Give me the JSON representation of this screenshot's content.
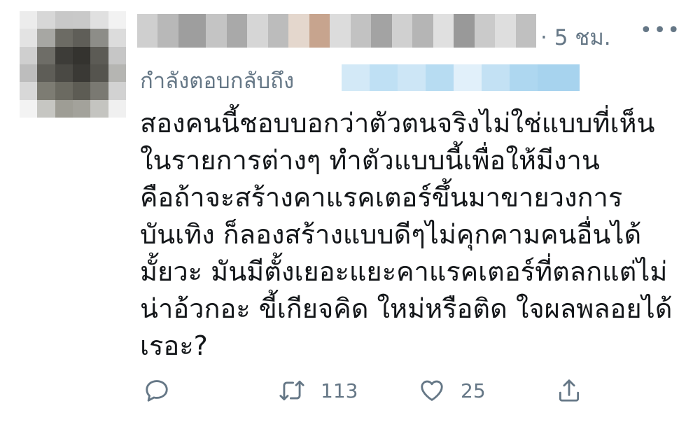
{
  "tweet": {
    "timestamp": "· 5 ชม.",
    "more_icon": "more-dots-icon",
    "reply_label": "กำลังตอบกลับถึง",
    "text_lines": [
      "สองคนนี้ชอบบอกว่าตัวตนจริงไม่ใช่แบบที่เห็น",
      "ในรายการต่างๆ ทำตัวแบบนี้เพื่อให้มีงาน",
      "คือถ้าจะสร้างคาแรคเตอร์ขึ้นมาขายวงการ",
      "บันเทิง ก็ลองสร้างแบบดีๆไม่คุกคามคนอื่นได้",
      "มั้ยวะ มันมีตั้งเยอะแยะคาแรคเตอร์ที่ตลกแต่ไม่",
      "น่าอ้วกอะ ขี้เกียจคิด ใหม่หรือติด ใจผลพลอยได้",
      "เรอะ?"
    ],
    "actions": {
      "reply_icon": "reply-icon",
      "retweet_icon": "retweet-icon",
      "retweet_count": "113",
      "like_icon": "heart-icon",
      "like_count": "25",
      "share_icon": "share-icon"
    }
  },
  "colors": {
    "text": "#14171a",
    "muted": "#657786",
    "background": "#ffffff"
  }
}
